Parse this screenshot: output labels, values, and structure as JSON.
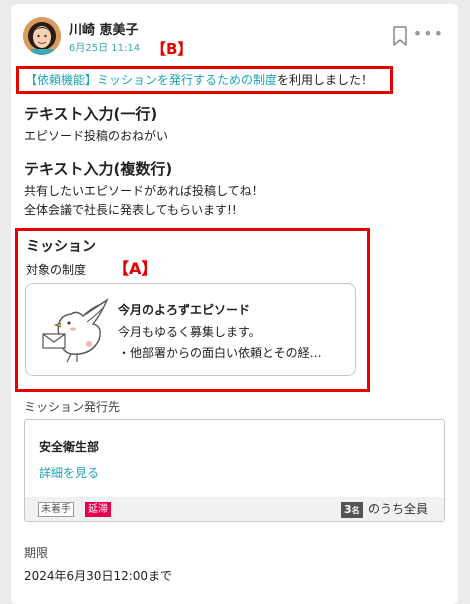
{
  "post": {
    "author": "川崎 恵美子",
    "date": "6月25日 11:14"
  },
  "callouts": {
    "a": "【A】",
    "b": "【B】"
  },
  "notice": {
    "link": "【依頼機能】ミッションを発行するための制度",
    "suffix": "を利用しました！"
  },
  "fields": {
    "single_heading": "テキスト入力(一行)",
    "single_value": "エピソード投稿のおねがい",
    "multi_heading": "テキスト入力(複数行)",
    "multi_line1": "共有したいエピソードがあれば投稿してね！",
    "multi_line2": "全体会議で社長に発表してもらいます!!"
  },
  "mission": {
    "title": "ミッション",
    "label": "対象の制度",
    "card_title": "今月のよろずエピソード",
    "card_line1": "今月もゆるく募集します。",
    "card_line2": "・他部署からの面白い依頼とその経…"
  },
  "destination": {
    "label": "ミッション発行先",
    "name": "安全衛生部",
    "detail_link": "詳細を見る",
    "tag_pending": "未着手",
    "tag_overdue": "延滞",
    "count": "3",
    "count_unit": "名",
    "count_text": "のうち全員"
  },
  "deadline": {
    "label": "期限",
    "value": "2024年6月30日12:00まで"
  },
  "colors": {
    "accent": "#1da4b3",
    "annotation": "#e60000",
    "overdue": "#e8004d"
  },
  "icons": [
    "avatar",
    "bookmark-icon",
    "more-icon",
    "envelope-bird-icon"
  ]
}
